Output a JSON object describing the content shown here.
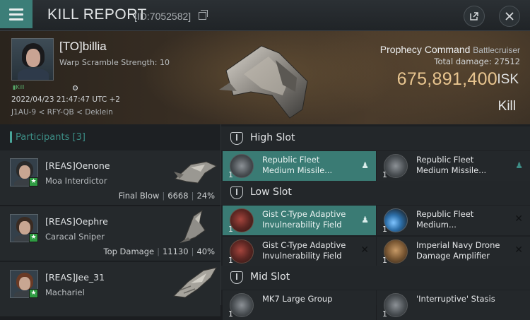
{
  "header": {
    "title": "KILL REPORT",
    "id_text": "[ID:7052582]"
  },
  "victim": {
    "name": "[TO]billia",
    "warp_scramble": "Warp Scramble Strength: 10",
    "tag": "Kill",
    "datetime": "2022/04/23 21:47:47 UTC +2",
    "location": "J1AU-9 < RFY-QB < Deklein",
    "ship_name": "Prophecy Command",
    "ship_class": "Battlecruiser",
    "total_damage_label": "Total damage:",
    "total_damage": "27512",
    "isk_value": "675,891,400",
    "isk_unit": "ISK",
    "result": "Kill"
  },
  "participants": {
    "label": "Participants",
    "count": "[3]",
    "rows": [
      {
        "name": "[REAS]Oenone",
        "ship": "Moa Interdictor",
        "stat_label": "Final Blow",
        "damage": "6668",
        "percent": "24%",
        "hair": "#2a2a2a"
      },
      {
        "name": "[REAS]Oephre",
        "ship": "Caracal Sniper",
        "stat_label": "Top Damage",
        "damage": "11130",
        "percent": "40%",
        "hair": "#3a2b22"
      },
      {
        "name": "[REAS]Jee_31",
        "ship": "Machariel",
        "stat_label": "",
        "damage": "",
        "percent": "",
        "hair": "#6a3a25"
      }
    ]
  },
  "slots": {
    "high": {
      "title": "High Slot",
      "modules": [
        {
          "name": "Republic Fleet Medium Missile...",
          "qty": "1",
          "status": "person",
          "icon": "launcher",
          "active": true
        },
        {
          "name": "Republic Fleet Medium Missile...",
          "qty": "1",
          "status": "person",
          "icon": "launcher",
          "active": false
        }
      ]
    },
    "low": {
      "title": "Low Slot",
      "modules": [
        {
          "name": "Gist C-Type Adaptive Invulnerability Field",
          "qty": "1",
          "status": "person",
          "icon": "red",
          "active": true
        },
        {
          "name": "Republic Fleet Medium...",
          "qty": "1",
          "status": "x",
          "icon": "blue",
          "active": false
        },
        {
          "name": "Gist C-Type Adaptive Invulnerability Field",
          "qty": "1",
          "status": "x",
          "icon": "red",
          "active": false
        },
        {
          "name": "Imperial Navy Drone Damage Amplifier",
          "qty": "1",
          "status": "x",
          "icon": "brass",
          "active": false
        }
      ]
    },
    "mid": {
      "title": "Mid Slot",
      "modules": [
        {
          "name": "MK7 Large Group",
          "qty": "1",
          "status": "",
          "icon": "launcher",
          "active": false
        },
        {
          "name": "'Interruptive' Stasis",
          "qty": "1",
          "status": "",
          "icon": "launcher",
          "active": false
        }
      ]
    }
  },
  "icons": {
    "menu": "hamburger-icon",
    "share": "share-icon",
    "close": "close-icon",
    "copy": "copy-icon",
    "slot": "shield-slot-icon",
    "person": "person-icon",
    "remove": "x-icon"
  }
}
